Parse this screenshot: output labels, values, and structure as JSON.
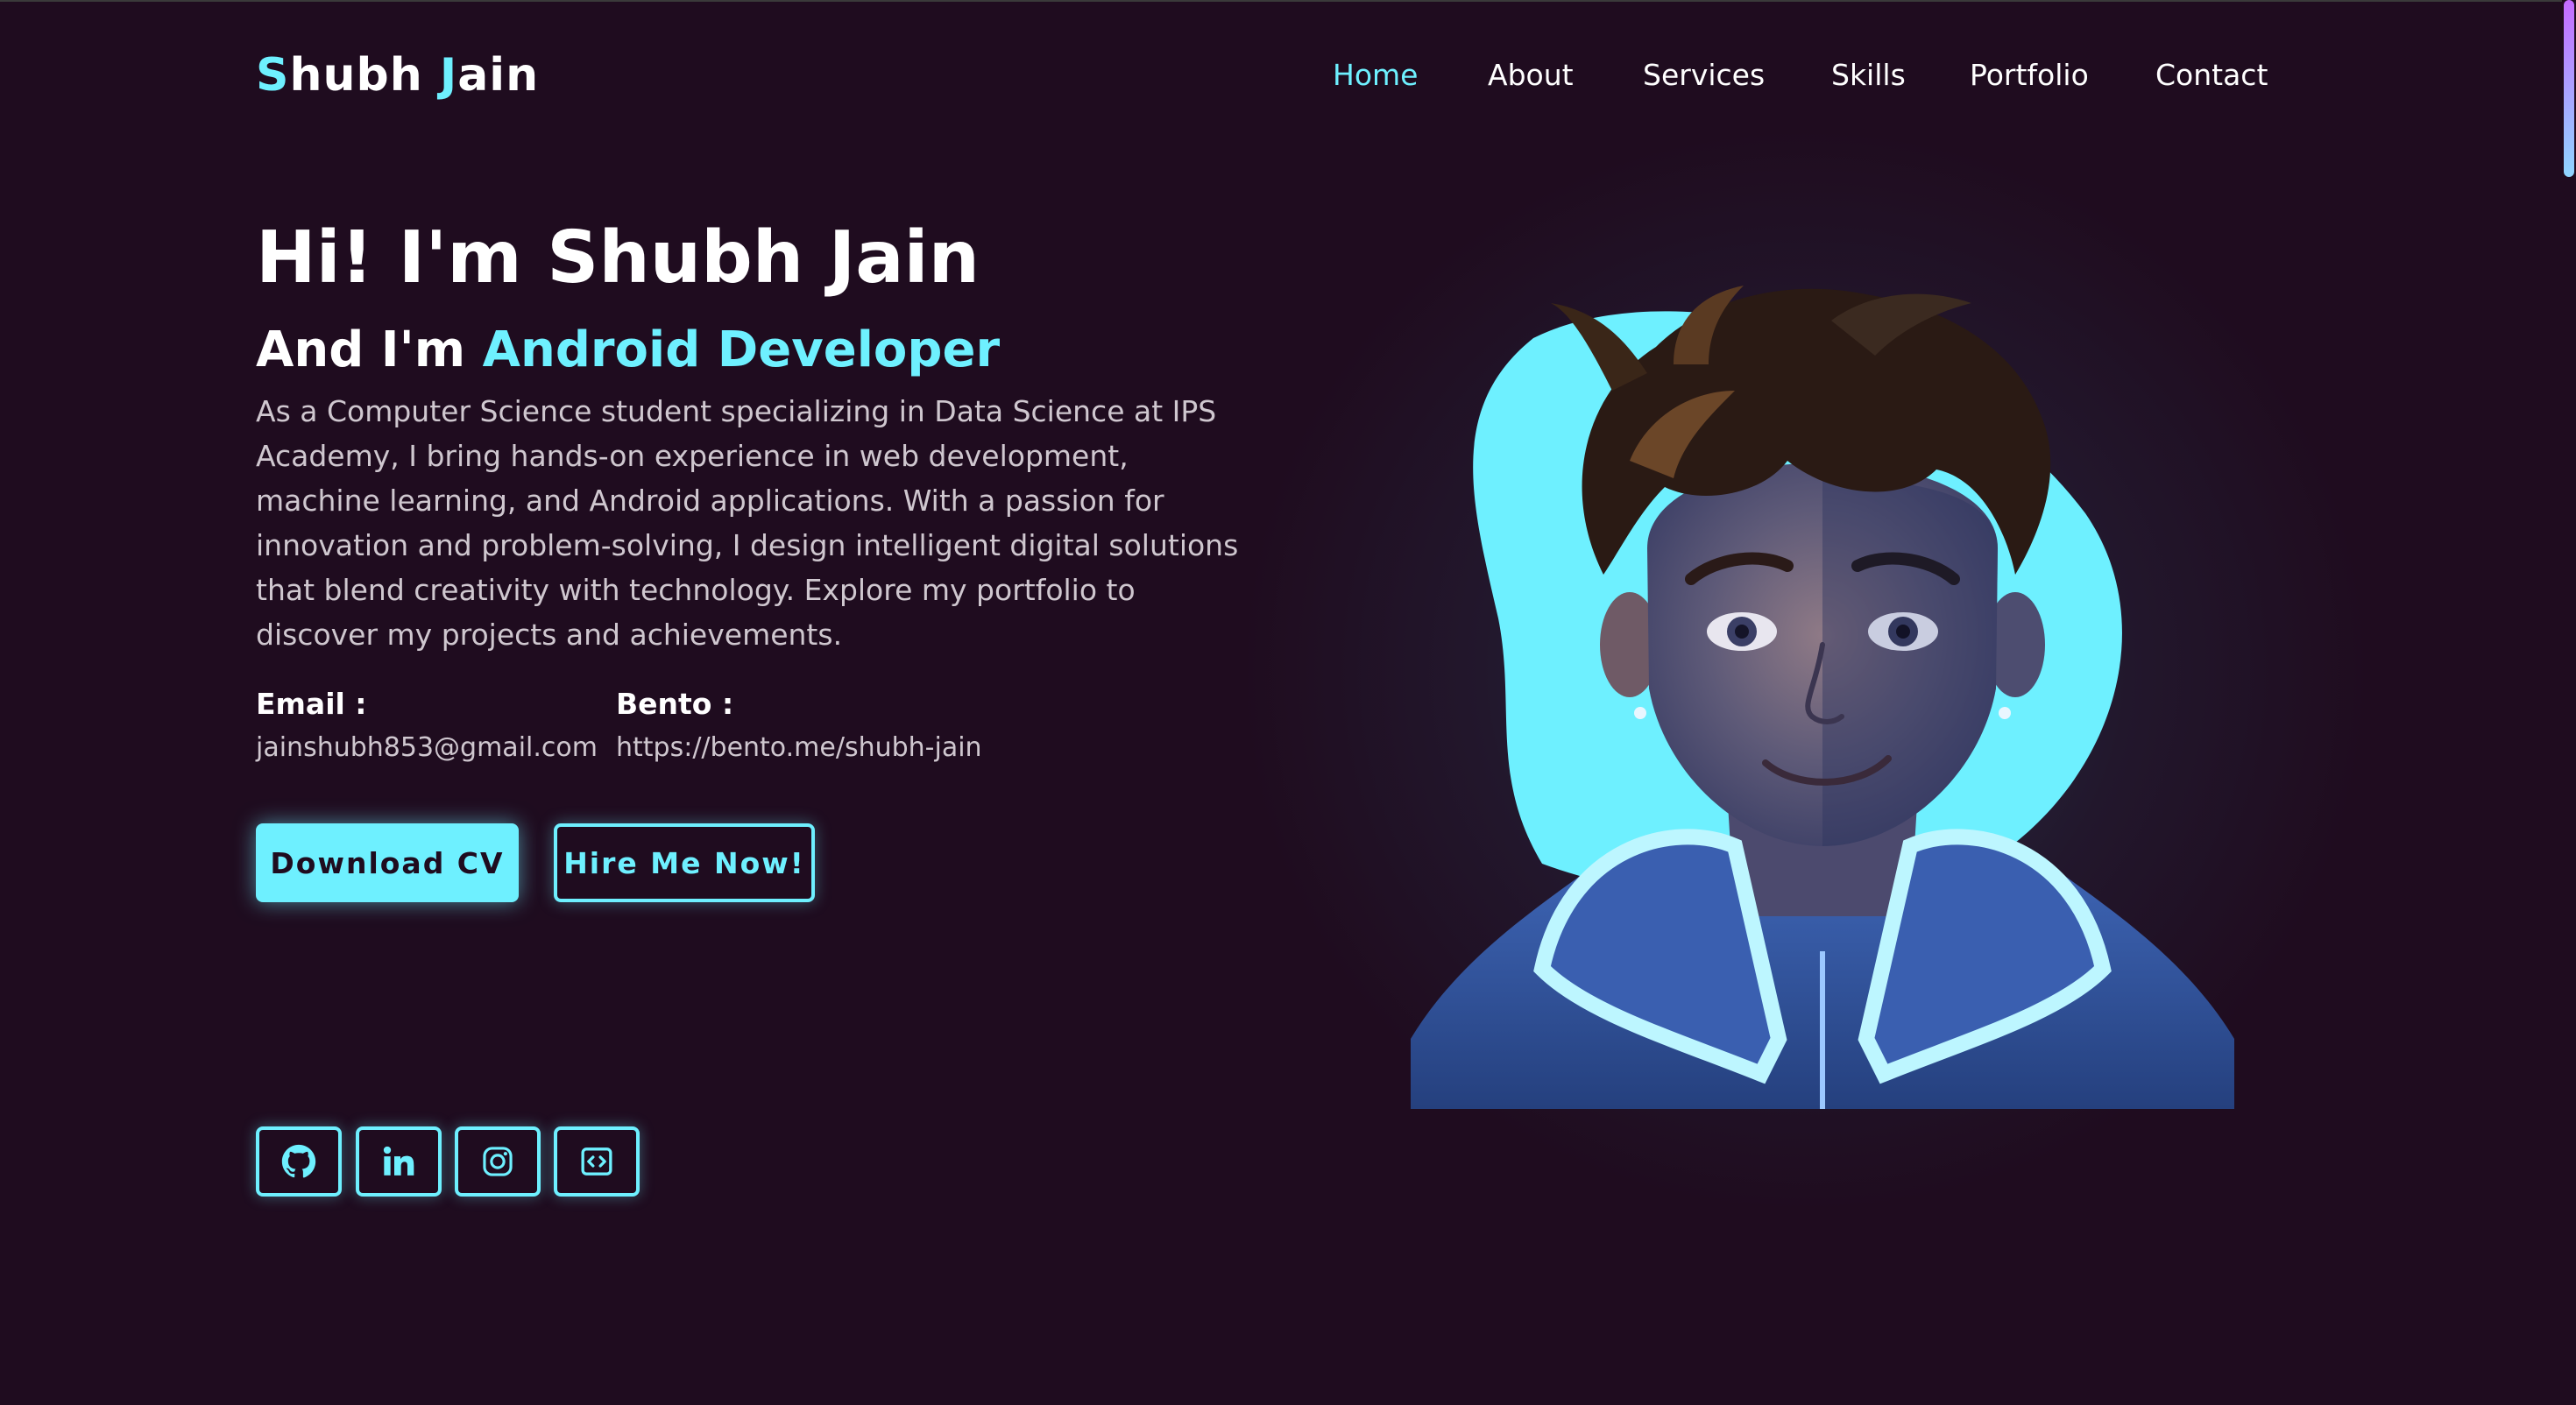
{
  "header": {
    "logo": {
      "first_initial": "S",
      "first_rest": "hubh ",
      "last_initial": "J",
      "last_rest": "ain"
    },
    "nav": [
      {
        "label": "Home",
        "active": true
      },
      {
        "label": "About",
        "active": false
      },
      {
        "label": "Services",
        "active": false
      },
      {
        "label": "Skills",
        "active": false
      },
      {
        "label": "Portfolio",
        "active": false
      },
      {
        "label": "Contact",
        "active": false
      }
    ]
  },
  "hero": {
    "title": "Hi! I'm Shubh Jain",
    "subtitle_prefix": "And I'm ",
    "role": "Android Developer",
    "description": "As a Computer Science student specializing in Data Science at IPS Academy, I bring hands-on experience in web development, machine learning, and Android applications. With a passion for innovation and problem-solving, I design intelligent digital solutions that blend creativity with technology. Explore my portfolio to discover my projects and achievements.",
    "email_label": "Email :",
    "email_value": "jainshubh853@gmail.com",
    "bento_label": "Bento :",
    "bento_value": "https://bento.me/shubh-jain",
    "buttons": {
      "download": "Download CV",
      "hire": "Hire Me Now!"
    },
    "socials": [
      {
        "icon": "github-icon"
      },
      {
        "icon": "linkedin-icon"
      },
      {
        "icon": "instagram-icon"
      },
      {
        "icon": "code-icon"
      }
    ]
  },
  "colors": {
    "background": "#1f0c1f",
    "accent": "#6ef0ff",
    "text": "#ffffff",
    "muted": "#cfc7cf"
  }
}
